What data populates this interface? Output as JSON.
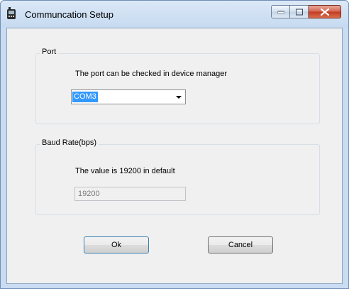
{
  "window": {
    "title": "Communcation Setup",
    "icon": "device-icon"
  },
  "caption_buttons": [
    "minimize-icon",
    "maximize-icon",
    "close-icon"
  ],
  "port_group": {
    "title": "Port",
    "description": "The port can be checked in device manager",
    "selected_port": "COM3"
  },
  "baud_group": {
    "title": "Baud Rate(bps)",
    "description": "The value is 19200 in default",
    "value": "19200"
  },
  "buttons": {
    "ok": "Ok",
    "cancel": "Cancel"
  }
}
